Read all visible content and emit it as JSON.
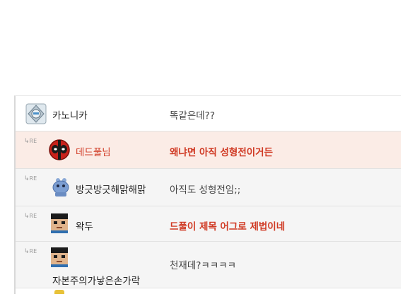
{
  "reply_tag": "RE",
  "comments": [
    {
      "nickname": "카노니카",
      "message": "똑같은데??",
      "avatar": "robot-knight-avatar-icon",
      "reply": false,
      "highlight": false
    },
    {
      "nickname": "데드풀님",
      "message": "왜냐면 아직 성형전이거든",
      "avatar": "deadpool-mask-avatar-icon",
      "reply": true,
      "highlight": true
    },
    {
      "nickname": "방긋방긋해맑해맑",
      "message": "아직도 성형전임;;",
      "avatar": "blue-creature-avatar-icon",
      "reply": true,
      "highlight": false
    },
    {
      "nickname": "왁두",
      "message": "드풀이 제목 어그로 제법이네",
      "avatar": "pixel-face-avatar-icon",
      "reply": true,
      "highlight": false
    },
    {
      "nickname": "자본주의가낳은손가락",
      "message": "천재데?ㅋㅋㅋㅋ",
      "avatar": "pixel-face-avatar-icon",
      "reply": true,
      "highlight": false
    }
  ],
  "colors": {
    "highlight_bg": "#fbece6",
    "accent_red": "#d03a24",
    "row_bg": "#f5f5f5",
    "border": "#e2e2e2"
  }
}
